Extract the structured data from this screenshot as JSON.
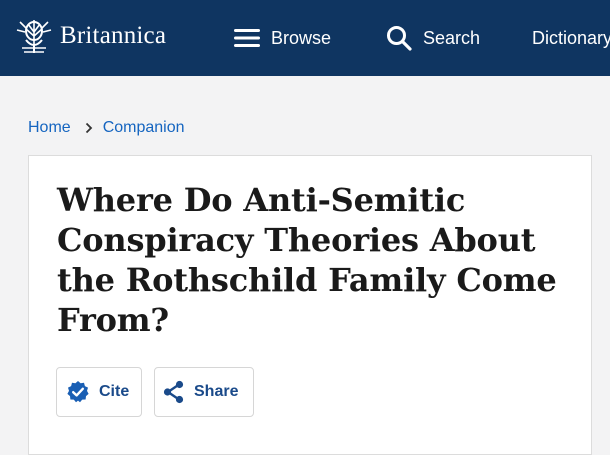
{
  "header": {
    "logo_text": "Britannica",
    "nav": {
      "browse": "Browse",
      "search": "Search",
      "dictionary": "Dictionary"
    }
  },
  "breadcrumb": {
    "home": "Home",
    "companion": "Companion"
  },
  "article": {
    "title": "Where Do Anti-Semitic Conspiracy Theories About the Rothschild Family Come From?",
    "actions": {
      "cite": "Cite",
      "share": "Share"
    }
  },
  "colors": {
    "header_bg": "#0f3561",
    "link": "#1565c0",
    "action_text": "#1a4a8a"
  }
}
